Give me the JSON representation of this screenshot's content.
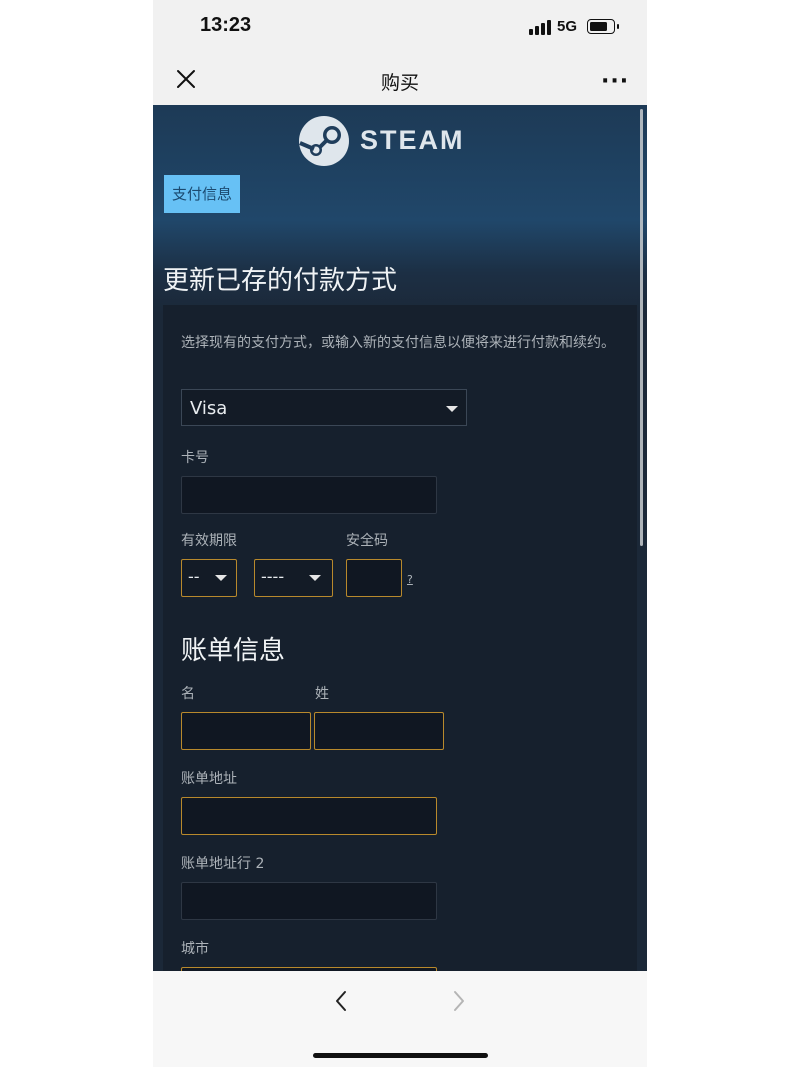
{
  "status": {
    "time": "13:23",
    "network": "5G"
  },
  "nav": {
    "title": "购买",
    "more": "···"
  },
  "brand": {
    "name": "STEAM"
  },
  "tab": {
    "label": "支付信息"
  },
  "page": {
    "title": "更新已存的付款方式",
    "intro": "选择现有的支付方式，或输入新的支付信息以便将来进行付款和续约。"
  },
  "payment": {
    "method_selected": "Visa",
    "card_label": "卡号",
    "expiry_label": "有效期限",
    "month_selected": "--",
    "year_selected": "----",
    "cvv_label": "安全码",
    "cvv_help": "?"
  },
  "billing": {
    "title": "账单信息",
    "first_name_label": "名",
    "last_name_label": "姓",
    "address_label": "账单地址",
    "address2_label": "账单地址行 2",
    "city_label": "城市"
  },
  "colors": {
    "page_bg": "#1b2838",
    "panel_bg": "#16202d",
    "tab_bg": "#67c1f5",
    "error_border": "#b8892c"
  }
}
